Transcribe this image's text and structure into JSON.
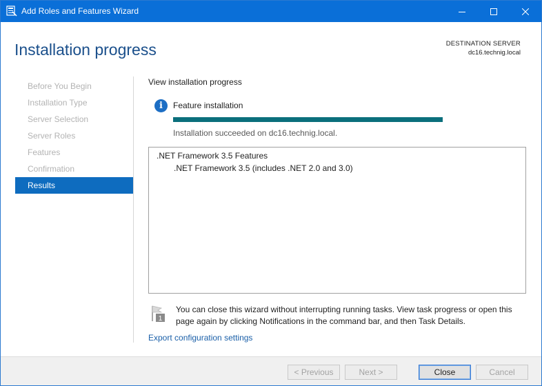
{
  "window": {
    "title": "Add Roles and Features Wizard"
  },
  "header": {
    "page_title": "Installation progress",
    "destination_label": "DESTINATION SERVER",
    "destination_server": "dc16.technig.local"
  },
  "nav": {
    "items": [
      {
        "label": "Before You Begin",
        "active": false
      },
      {
        "label": "Installation Type",
        "active": false
      },
      {
        "label": "Server Selection",
        "active": false
      },
      {
        "label": "Server Roles",
        "active": false
      },
      {
        "label": "Features",
        "active": false
      },
      {
        "label": "Confirmation",
        "active": false
      },
      {
        "label": "Results",
        "active": true
      }
    ]
  },
  "content": {
    "heading": "View installation progress",
    "feature_label": "Feature installation",
    "progress_percent": 100,
    "status": "Installation succeeded on dc16.technig.local.",
    "results": {
      "parent": ".NET Framework 3.5 Features",
      "child": ".NET Framework 3.5 (includes .NET 2.0 and 3.0)"
    },
    "notice": "You can close this wizard without interrupting running tasks. View task progress or open this page again by clicking Notifications in the command bar, and then Task Details.",
    "notice_badge": "1",
    "export_link": "Export configuration settings"
  },
  "footer": {
    "previous": "< Previous",
    "next": "Next >",
    "close": "Close",
    "cancel": "Cancel"
  },
  "colors": {
    "titlebar": "#0a6fd8",
    "accent_nav": "#0e6cbf",
    "progress": "#0b6f7c",
    "title_text": "#1a4f8b",
    "link": "#1a5fa8"
  }
}
